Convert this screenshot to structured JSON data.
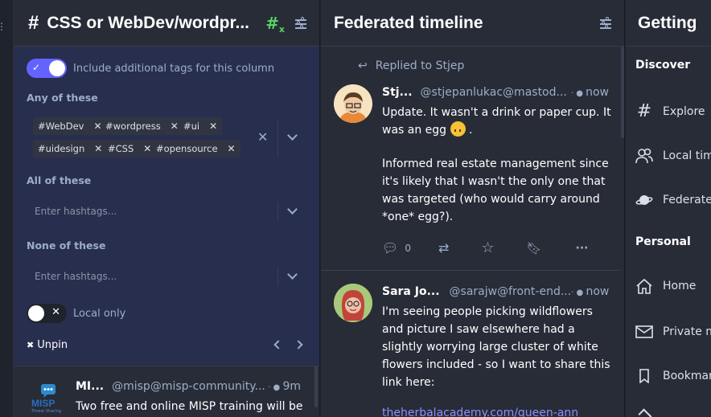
{
  "col_hashtag": {
    "title": "CSS or WebDev/wordpr...",
    "include_label": "Include additional tags for this column",
    "any_label": "Any of these",
    "any_tags": [
      "#WebDev",
      "#wordpress",
      "#ui",
      "#uidesign",
      "#CSS",
      "#opensource"
    ],
    "all_label": "All of these",
    "all_placeholder": "Enter hashtags...",
    "none_label": "None of these",
    "none_placeholder": "Enter hashtags...",
    "local_only_label": "Local only",
    "unpin_label": "Unpin",
    "status": {
      "name": "MI...",
      "acct": "@misp@misp-community...",
      "time": "9m",
      "text": "Two free and online MISP training will be",
      "avatar_text": "MISP",
      "avatar_sub": "Threat Sharing"
    }
  },
  "col_federated": {
    "title": "Federated timeline",
    "replied_to": "Replied to Stjep",
    "status1": {
      "name": "Stj...",
      "acct": "@stjepanlukac@mastod...",
      "time": "now",
      "p1_a": "Update. It wasn't a drink or paper cup. It",
      "p1_b": "was an egg",
      "p1_end": ".",
      "p2_1": "Informed real estate management since",
      "p2_2": "it's likely that I wasn't the only one that",
      "p2_3": "was targeted (who would carry around",
      "p2_4": "*one* egg?).",
      "reply_count": "0"
    },
    "status2": {
      "name": "Sara Jo...",
      "acct": "@sarajw@front-end...",
      "time": "now",
      "l1": "I'm seeing people picking wildflowers",
      "l2": "and picture I saw elsewhere had a",
      "l3": "slightly worrying large cluster of white",
      "l4": "flowers included - so I want to share this",
      "l5": "link here:",
      "link": "theherbalacademy.com/queen-ann"
    }
  },
  "col_getting_started": {
    "title": "Getting sta",
    "discover_heading": "Discover",
    "explore": "Explore",
    "local": "Local tim",
    "federated": "Federated",
    "personal_heading": "Personal",
    "home": "Home",
    "private": "Private m",
    "bookmarks": "Bookmar"
  },
  "colors": {
    "accent": "#6364ff",
    "link": "#8c8dff",
    "bg_column": "#282c37",
    "bg_settings": "#282f4e",
    "muted": "#9baec8",
    "hashtag_toggle": "#56d364"
  }
}
